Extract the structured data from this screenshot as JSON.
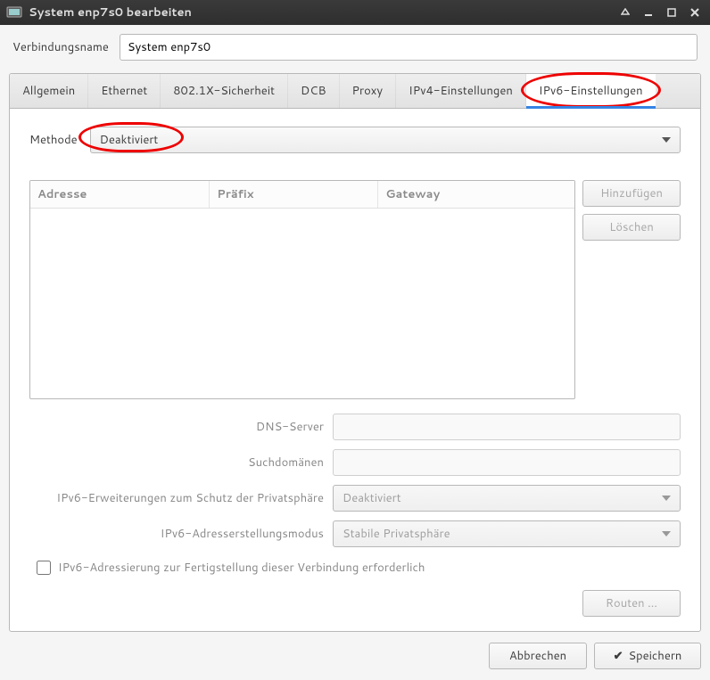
{
  "window": {
    "title": "System enp7s0 bearbeiten"
  },
  "connection": {
    "name_label": "Verbindungsname",
    "name_value": "System enp7s0"
  },
  "tabs": [
    {
      "label": "Allgemein"
    },
    {
      "label": "Ethernet"
    },
    {
      "label": "802.1X-Sicherheit"
    },
    {
      "label": "DCB"
    },
    {
      "label": "Proxy"
    },
    {
      "label": "IPv4-Einstellungen"
    },
    {
      "label": "IPv6-Einstellungen"
    }
  ],
  "ipv6": {
    "method_label": "Methode",
    "method_value": "Deaktiviert",
    "columns": {
      "address": "Adresse",
      "prefix": "Präfix",
      "gateway": "Gateway"
    },
    "buttons": {
      "add": "Hinzufügen",
      "delete": "Löschen",
      "routes": "Routen …"
    },
    "fields": {
      "dns_label": "DNS-Server",
      "dns_value": "",
      "search_label": "Suchdomänen",
      "search_value": "",
      "privacy_label": "IPv6-Erweiterungen zum Schutz der Privatsphäre",
      "privacy_value": "Deaktiviert",
      "addrgen_label": "IPv6-Adresserstellungsmodus",
      "addrgen_value": "Stabile Privatsphäre",
      "required_label": "IPv6-Adressierung zur Fertigstellung dieser Verbindung erforderlich"
    }
  },
  "actions": {
    "cancel": "Abbrechen",
    "save": "Speichern"
  }
}
